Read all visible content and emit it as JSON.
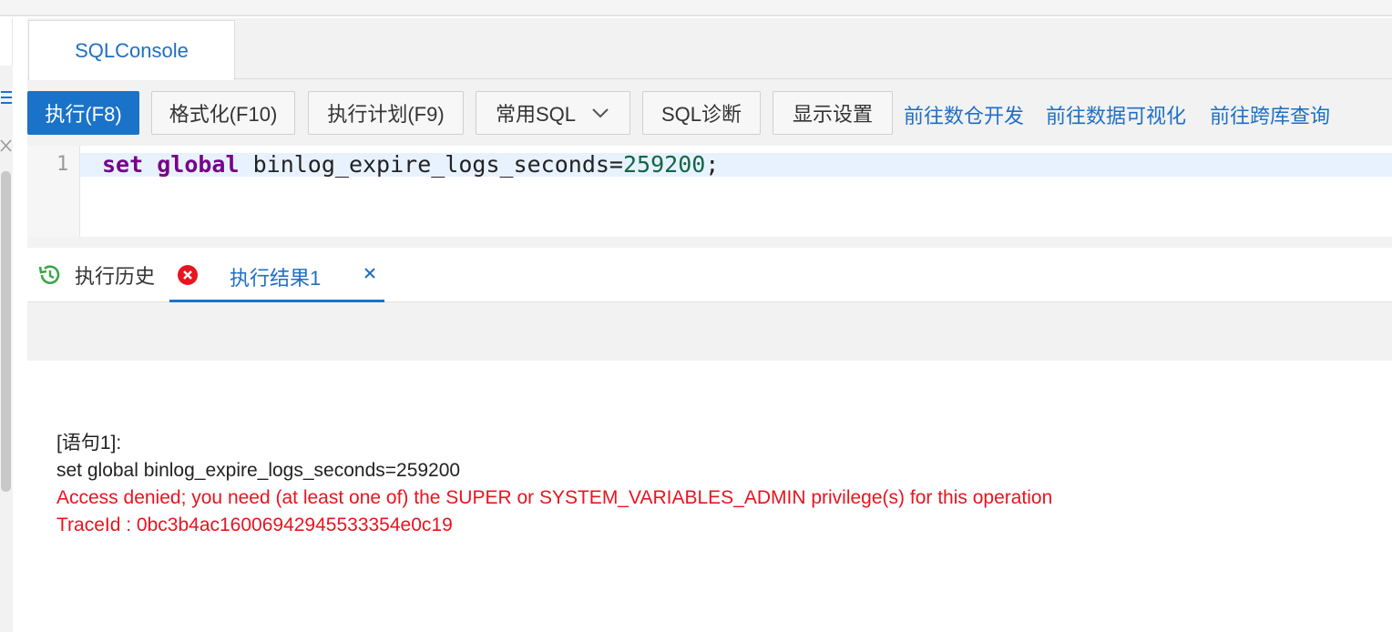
{
  "tabs": [
    {
      "label": "SQLConsole",
      "active": true
    }
  ],
  "toolbar": {
    "execute": "执行(F8)",
    "format": "格式化(F10)",
    "plan": "执行计划(F9)",
    "common_sql": "常用SQL",
    "diagnose": "SQL诊断",
    "display": "显示设置",
    "links": [
      "前往数仓开发",
      "前往数据可视化",
      "前往跨库查询"
    ]
  },
  "editor": {
    "line_number": "1",
    "tokens": {
      "kw1": "set",
      "kw2": "global",
      "rest": "binlog_expire_logs_seconds=",
      "num": "259200",
      "tail": ";"
    }
  },
  "result_tabs": {
    "history": "执行历史",
    "result": "执行结果1"
  },
  "result": {
    "statement_label": "[语句1]:",
    "statement": "set global binlog_expire_logs_seconds=259200",
    "error": "Access denied; you need (at least one of) the SUPER or SYSTEM_VARIABLES_ADMIN privilege(s) for this operation",
    "trace": "TraceId : 0bc3b4ac16006942945533354e0c19"
  },
  "colors": {
    "accent": "#1a73c9",
    "link": "#1f6fc5",
    "error": "#e8141f",
    "keyword": "#770088",
    "number": "#116644"
  }
}
